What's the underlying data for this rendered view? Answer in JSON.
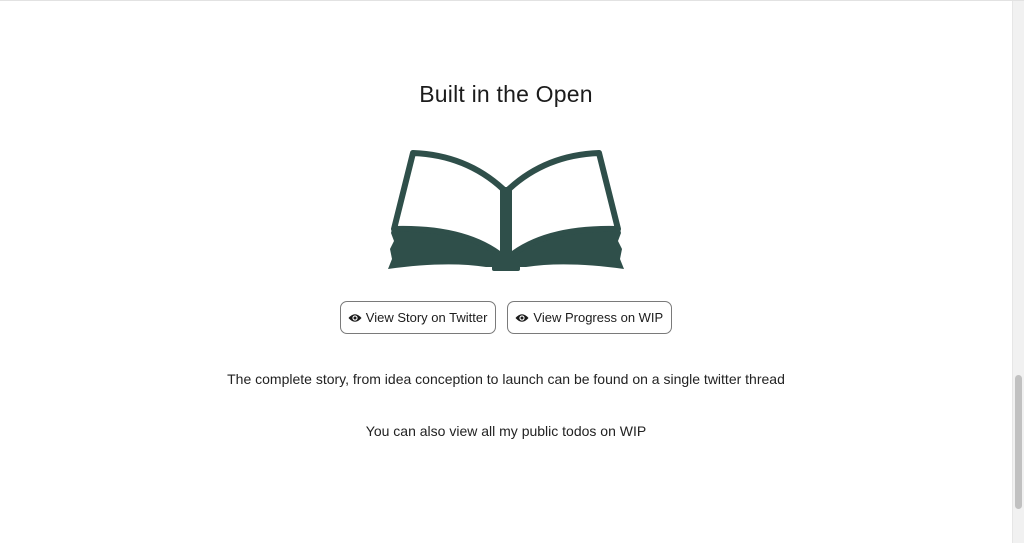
{
  "section": {
    "title": "Built in the Open"
  },
  "illustration": {
    "icon": "open-book-icon",
    "color": "#2f4f4a"
  },
  "buttons": [
    {
      "label": "View Story on Twitter",
      "icon": "eye-icon"
    },
    {
      "label": "View Progress on WIP",
      "icon": "eye-icon"
    }
  ],
  "text": {
    "line1": "The complete story, from idea conception to launch can be found on a single twitter thread",
    "line2": "You can also view all my public todos on WIP"
  }
}
